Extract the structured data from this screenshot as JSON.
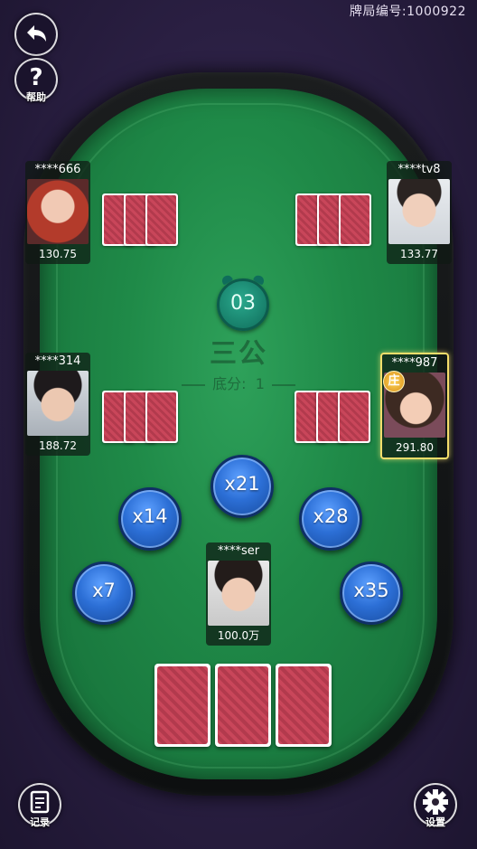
{
  "header": {
    "room_label": "牌局编号:",
    "room_id": "1000922"
  },
  "buttons": {
    "back_icon": "back-arrow-icon",
    "help_label": "帮助",
    "record_label": "记录",
    "settings_label": "设置"
  },
  "table": {
    "game_title": "三公",
    "base_label": "底分:",
    "base_value": "1",
    "timer": "03"
  },
  "players": {
    "top_left": {
      "name": "****666",
      "score": "130.75"
    },
    "top_right": {
      "name": "****tv8",
      "score": "133.77"
    },
    "mid_left": {
      "name": "****314",
      "score": "188.72"
    },
    "mid_right": {
      "name": "****987",
      "score": "291.80",
      "badge": "庄"
    },
    "self": {
      "name": "****ser",
      "score": "100.0万"
    }
  },
  "bets": [
    "x7",
    "x14",
    "x21",
    "x28",
    "x35"
  ],
  "colors": {
    "felt": "#1f8a48",
    "chip": "#2c6fd6",
    "card_back": "#c9465a",
    "dealer_border": "#f5de6b"
  }
}
